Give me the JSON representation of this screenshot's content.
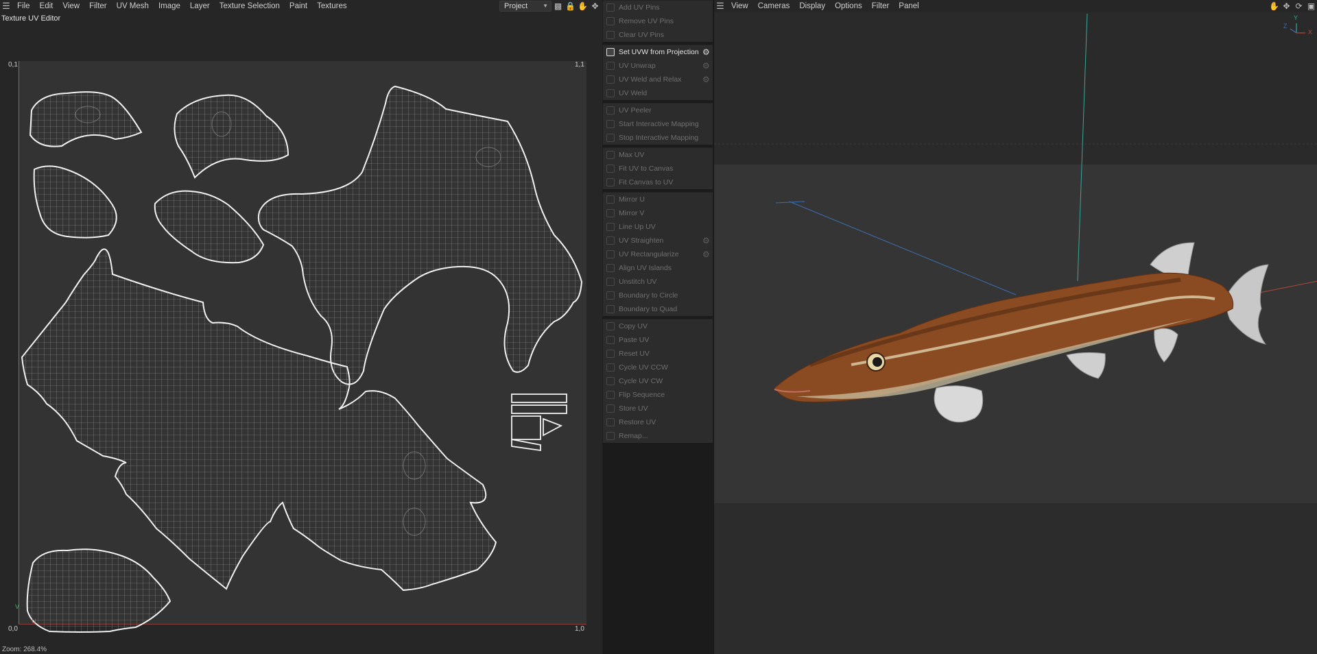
{
  "uv_editor": {
    "menu": [
      "File",
      "Edit",
      "View",
      "Filter",
      "UV Mesh",
      "Image",
      "Layer",
      "Texture Selection",
      "Paint",
      "Textures"
    ],
    "title": "Texture UV Editor",
    "project_select": "Project",
    "corners": {
      "top_left": "0,1",
      "top_right": "1,1",
      "bottom_left": "0,0",
      "bottom_right": "1,0",
      "v_axis": "V",
      "u_axis": "U"
    },
    "status": "Zoom: 268.4%",
    "icons": [
      "histogram-icon",
      "lock-icon",
      "hand-icon",
      "move-icon"
    ]
  },
  "commands": {
    "groups": [
      [
        {
          "label": "Add UV Pins",
          "enabled": false,
          "gear": false
        },
        {
          "label": "Remove UV Pins",
          "enabled": false,
          "gear": false
        },
        {
          "label": "Clear UV Pins",
          "enabled": false,
          "gear": false
        }
      ],
      [
        {
          "label": "Set UVW from Projection",
          "enabled": true,
          "gear": true
        },
        {
          "label": "UV Unwrap",
          "enabled": false,
          "gear": true
        },
        {
          "label": "UV Weld and Relax",
          "enabled": false,
          "gear": true
        },
        {
          "label": "UV Weld",
          "enabled": false,
          "gear": false
        }
      ],
      [
        {
          "label": "UV Peeler",
          "enabled": false,
          "gear": false
        },
        {
          "label": "Start Interactive Mapping",
          "enabled": false,
          "gear": false
        },
        {
          "label": "Stop Interactive Mapping",
          "enabled": false,
          "gear": false
        }
      ],
      [
        {
          "label": "Max UV",
          "enabled": false,
          "gear": false
        },
        {
          "label": "Fit UV to Canvas",
          "enabled": false,
          "gear": false
        },
        {
          "label": "Fit Canvas to UV",
          "enabled": false,
          "gear": false
        }
      ],
      [
        {
          "label": "Mirror U",
          "enabled": false,
          "gear": false
        },
        {
          "label": "Mirror V",
          "enabled": false,
          "gear": false
        },
        {
          "label": "Line Up UV",
          "enabled": false,
          "gear": false
        },
        {
          "label": "UV Straighten",
          "enabled": false,
          "gear": true
        },
        {
          "label": "UV Rectangularize",
          "enabled": false,
          "gear": true
        },
        {
          "label": "Align UV Islands",
          "enabled": false,
          "gear": false
        },
        {
          "label": "Unstitch UV",
          "enabled": false,
          "gear": false
        },
        {
          "label": "Boundary to Circle",
          "enabled": false,
          "gear": false
        },
        {
          "label": "Boundary to Quad",
          "enabled": false,
          "gear": false
        }
      ],
      [
        {
          "label": "Copy UV",
          "enabled": false,
          "gear": false
        },
        {
          "label": "Paste UV",
          "enabled": false,
          "gear": false
        },
        {
          "label": "Reset UV",
          "enabled": false,
          "gear": false
        },
        {
          "label": "Cycle UV CCW",
          "enabled": false,
          "gear": false
        },
        {
          "label": "Cycle UV CW",
          "enabled": false,
          "gear": false
        },
        {
          "label": "Flip Sequence",
          "enabled": false,
          "gear": false
        },
        {
          "label": "Store UV",
          "enabled": false,
          "gear": false
        },
        {
          "label": "Restore UV",
          "enabled": false,
          "gear": false
        },
        {
          "label": "Remap...",
          "enabled": false,
          "gear": false
        }
      ]
    ]
  },
  "viewport": {
    "menu": [
      "View",
      "Cameras",
      "Display",
      "Options",
      "Filter",
      "Panel"
    ],
    "axis_labels": {
      "y": "Y",
      "z": "Z",
      "x": "X"
    },
    "icons": [
      "hand-icon",
      "move-icon",
      "rotate-icon",
      "layout-icon"
    ],
    "colors": {
      "fish_body": "#8a4a22",
      "fin": "#cfcfcf",
      "y_axis": "#3aa896",
      "x_axis": "#b04a3a",
      "z_axis": "#3d6fb0"
    }
  }
}
